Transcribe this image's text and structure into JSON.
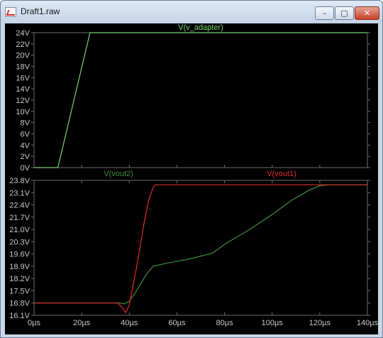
{
  "window": {
    "title": "Draft1.raw",
    "icon": "waveform-viewer-icon",
    "controls": {
      "minimize": "minimize-icon",
      "maximize": "maximize-icon",
      "close": "close-icon"
    }
  },
  "colors": {
    "background": "#000000",
    "grid": "#6e6e6e",
    "axis_text": "#c8c8c8",
    "v_adapter": "#7ad36f",
    "vout2": "#3f8f3f",
    "vout1": "#e02a2a"
  },
  "chart_data": [
    {
      "type": "line",
      "title": "V(v_adapter)",
      "x": [
        0,
        10,
        23.5,
        140
      ],
      "series": [
        {
          "name": "V(v_adapter)",
          "values": [
            0,
            0,
            24,
            24
          ]
        }
      ],
      "xlim": [
        0,
        140
      ],
      "ylim": [
        0,
        24
      ],
      "y_ticks": [
        "0V",
        "2V",
        "4V",
        "6V",
        "8V",
        "10V",
        "12V",
        "14V",
        "16V",
        "18V",
        "20V",
        "22V",
        "24V"
      ],
      "grid": false
    },
    {
      "type": "line",
      "x_tick_labels": [
        "0µs",
        "20µs",
        "40µs",
        "60µs",
        "80µs",
        "100µs",
        "120µs",
        "140µs"
      ],
      "xlim": [
        0,
        140
      ],
      "ylim": [
        16.1,
        23.8
      ],
      "y_ticks": [
        "16.1V",
        "16.8V",
        "17.5V",
        "18.2V",
        "18.9V",
        "19.6V",
        "20.3V",
        "21.0V",
        "21.7V",
        "22.4V",
        "23.1V",
        "23.8V"
      ],
      "series": [
        {
          "name": "V(vout2)",
          "x": [
            0,
            36,
            38,
            40,
            43,
            47,
            50,
            55,
            65,
            75,
            80,
            90,
            100,
            108,
            115,
            120,
            124,
            140
          ],
          "values": [
            16.8,
            16.8,
            16.75,
            16.9,
            17.5,
            18.4,
            18.9,
            19.05,
            19.3,
            19.65,
            20.15,
            20.95,
            21.85,
            22.65,
            23.2,
            23.5,
            23.55,
            23.55
          ]
        },
        {
          "name": "V(vout1)",
          "x": [
            0,
            35,
            37,
            38.5,
            40,
            43,
            46,
            48,
            50,
            51,
            52,
            140
          ],
          "values": [
            16.8,
            16.8,
            16.55,
            16.25,
            16.7,
            18.8,
            21.2,
            22.6,
            23.4,
            23.55,
            23.55,
            23.55
          ]
        }
      ]
    }
  ]
}
